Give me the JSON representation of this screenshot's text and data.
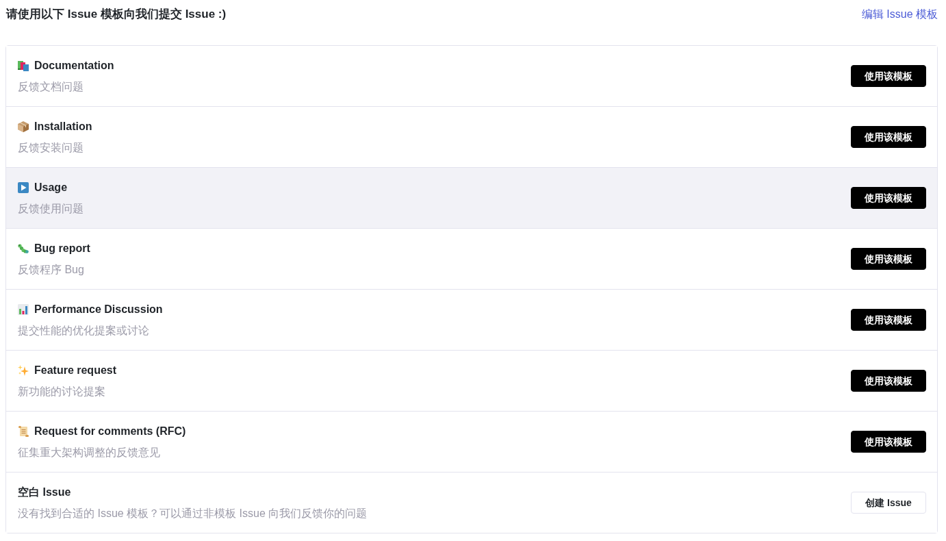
{
  "header": {
    "title": "请使用以下 Issue 模板向我们提交 Issue :)",
    "edit_link": "编辑 Issue 模板"
  },
  "templates": [
    {
      "kind": "template",
      "title": "Documentation",
      "description": "反馈文档问题",
      "button": "使用该模板",
      "highlighted": false
    },
    {
      "kind": "template",
      "title": "Installation",
      "description": "反馈安装问题",
      "button": "使用该模板",
      "highlighted": false
    },
    {
      "kind": "template",
      "title": "Usage",
      "description": "反馈使用问题",
      "button": "使用该模板",
      "highlighted": true
    },
    {
      "kind": "template",
      "title": "Bug report",
      "description": "反馈程序 Bug",
      "button": "使用该模板",
      "highlighted": false
    },
    {
      "kind": "template",
      "title": "Performance Discussion",
      "description": "提交性能的优化提案或讨论",
      "button": "使用该模板",
      "highlighted": false
    },
    {
      "kind": "template",
      "title": "Feature request",
      "description": "新功能的讨论提案",
      "button": "使用该模板",
      "highlighted": false
    },
    {
      "kind": "template",
      "title": "Request for comments (RFC)",
      "description": "征集重大架构调整的反馈意见",
      "button": "使用该模板",
      "highlighted": false
    },
    {
      "kind": "blank",
      "title": "空白 Issue",
      "description": "没有找到合适的 Issue 模板？可以通过非模板 Issue 向我们反馈你的问题",
      "button": "创建 Issue",
      "highlighted": false
    }
  ]
}
